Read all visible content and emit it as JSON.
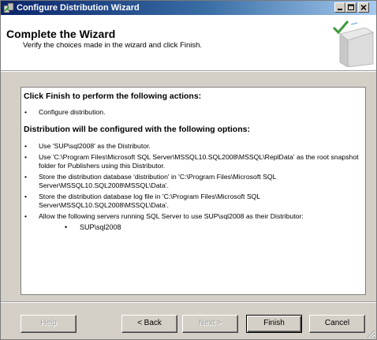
{
  "window": {
    "title": "Configure Distribution Wizard"
  },
  "header": {
    "title": "Complete the Wizard",
    "subtitle": "Verify the choices made in the wizard and click Finish."
  },
  "content": {
    "heading1": "Click Finish to perform the following actions:",
    "actions": [
      "Configure distribution."
    ],
    "heading2": "Distribution will be configured with the following options:",
    "options": [
      "Use 'SUP\\sql2008' as the Distributor.",
      "Use 'C:\\Program Files\\Microsoft SQL Server\\MSSQL10.SQL2008\\MSSQL\\ReplData' as the root snapshot folder for Publishers using this Distributor.",
      "Store the distribution database 'distribution' in 'C:\\Program Files\\Microsoft SQL Server\\MSSQL10.SQL2008\\MSSQL\\Data'.",
      "Store the distribution database log file in 'C:\\Program Files\\Microsoft SQL Server\\MSSQL10.SQL2008\\MSSQL\\Data'.",
      "Allow the following servers running SQL Server to use SUP\\sql2008 as their Distributor:"
    ],
    "servers": [
      "SUP\\sql2008"
    ],
    "bullet": "•"
  },
  "buttons": {
    "help": "Help",
    "back": "< Back",
    "next": "Next >",
    "finish": "Finish",
    "cancel": "Cancel"
  },
  "colors": {
    "titlebar_start": "#0a246a",
    "titlebar_end": "#a6caf0",
    "face": "#d4d0c8"
  }
}
